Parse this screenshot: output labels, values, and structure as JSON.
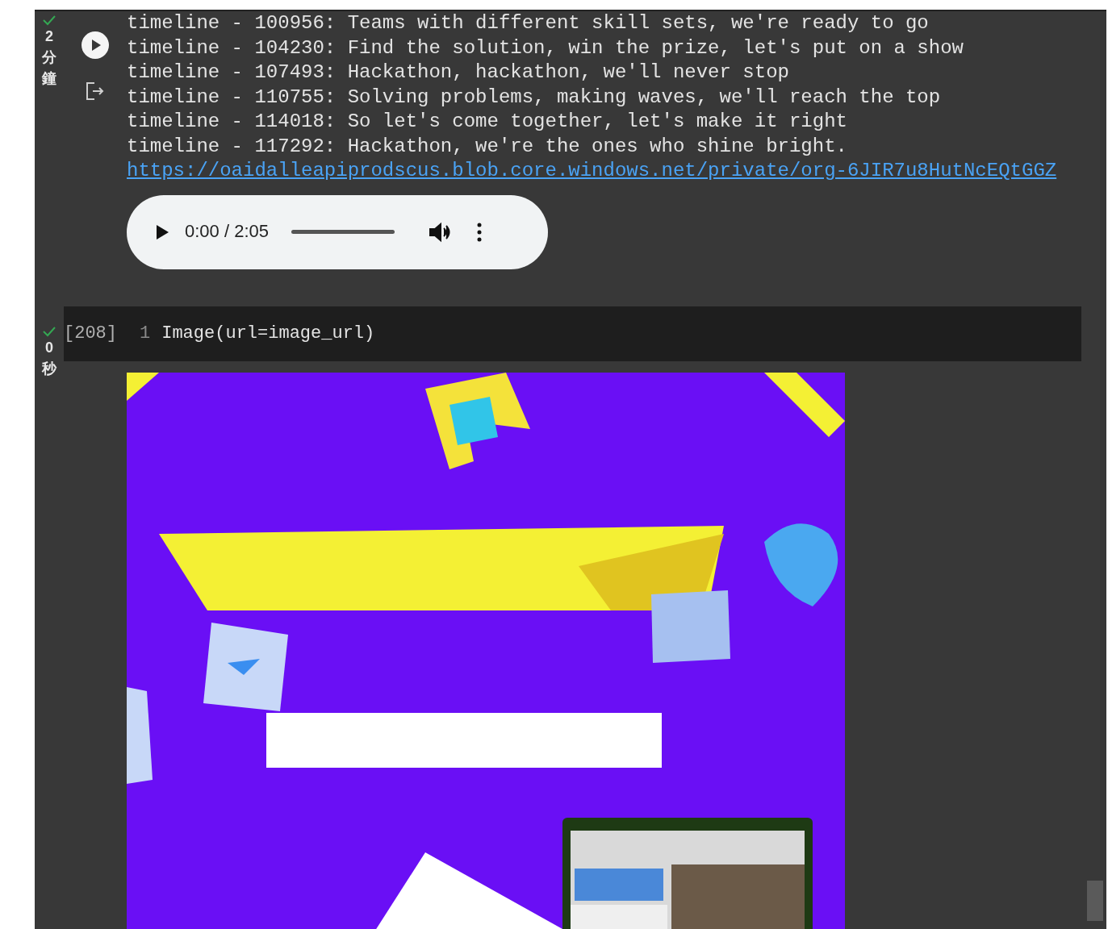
{
  "output_cell": {
    "done": true,
    "duration": [
      "2",
      "分",
      "鐘"
    ],
    "lines": [
      "timeline - 100956: Teams with different skill sets, we're ready to go",
      "timeline - 104230: Find the solution, win the prize, let's put on a show",
      "timeline - 107493: Hackathon, hackathon, we'll never stop",
      "timeline - 110755: Solving problems, making waves, we'll reach the top",
      "timeline - 114018: So let's come together, let's make it right",
      "timeline - 117292: Hackathon, we're the ones who shine bright."
    ],
    "link": "https://oaidalleapiprodscus.blob.core.windows.net/private/org-6JIR7u8HutNcEQtGGZ",
    "audio": {
      "time": "0:00 / 2:05",
      "level": 0
    }
  },
  "code_cell": {
    "done": true,
    "duration": [
      "0",
      "秒"
    ],
    "count": "[208]",
    "line_number": "1",
    "code": "Image(url=image_url)",
    "output": {
      "kind": "picture"
    }
  }
}
